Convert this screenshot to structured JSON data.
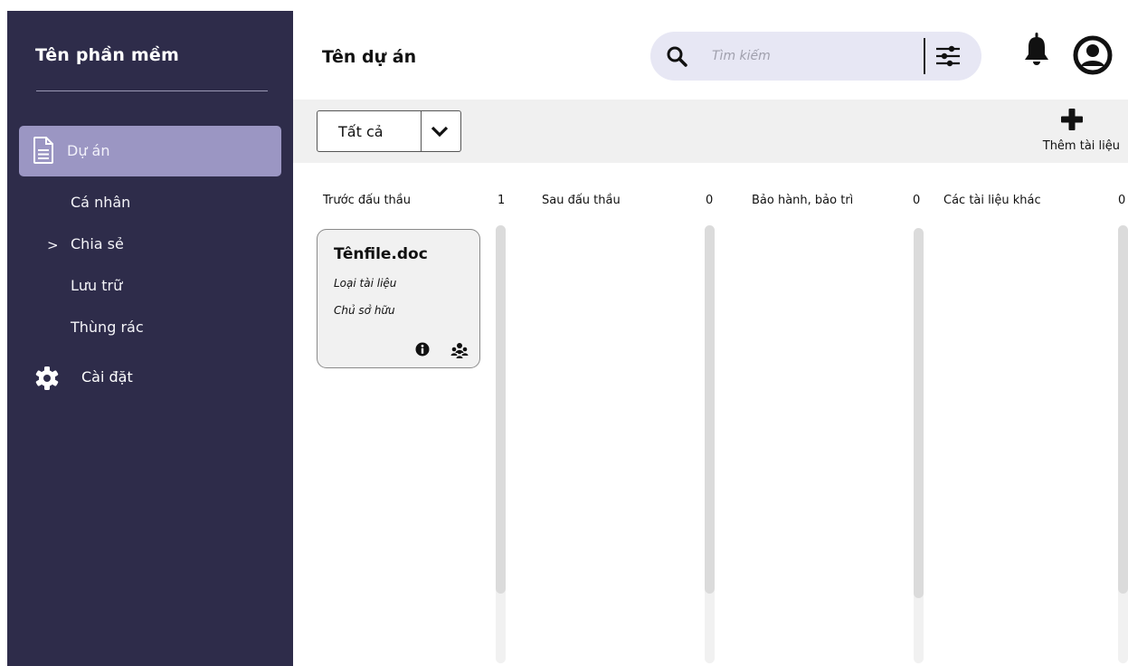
{
  "sidebar": {
    "app_title": "Tên phần mềm",
    "items": [
      {
        "label": "Dự án",
        "icon": "document-icon",
        "active": true
      },
      {
        "label": "Cá nhân"
      },
      {
        "label": "Chia sẻ",
        "expandable": true
      },
      {
        "label": "Lưu trữ"
      },
      {
        "label": "Thùng rác"
      },
      {
        "label": "Cài đặt",
        "icon": "gear-icon"
      }
    ],
    "chevron": ">"
  },
  "header": {
    "title": "Tên dự án",
    "search_placeholder": "Tìm kiếm"
  },
  "toolbar": {
    "filter_value": "Tất cả",
    "add_label": "Thêm tài liệu"
  },
  "columns": [
    {
      "title": "Trước đấu thầu",
      "count": "1"
    },
    {
      "title": "Sau đấu thầu",
      "count": "0"
    },
    {
      "title": "Bảo hành, bảo trì",
      "count": "0"
    },
    {
      "title": "Các tài liệu khác",
      "count": "0"
    }
  ],
  "card": {
    "filename": "Tênfile.doc",
    "type_label": "Loại tài liệu",
    "owner_label": "Chủ sở hữu"
  },
  "colors": {
    "sidebar_bg": "#2e2c4a",
    "active_item": "#9b96c3",
    "search_bg": "#e7e7f4"
  }
}
